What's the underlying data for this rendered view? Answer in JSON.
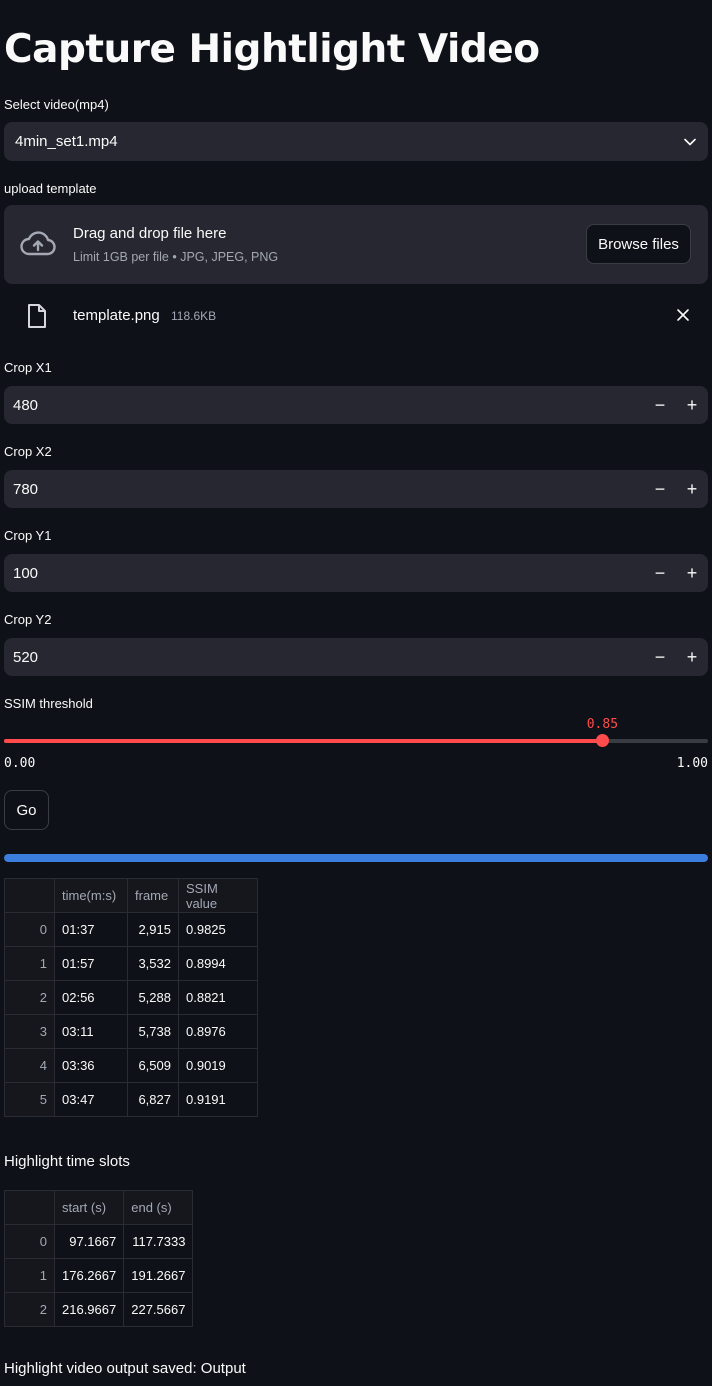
{
  "title": "Capture Hightlight Video",
  "video_select": {
    "label": "Select video(mp4)",
    "value": "4min_set1.mp4"
  },
  "uploader": {
    "label": "upload template",
    "drag_text": "Drag and drop file here",
    "limit_text": "Limit 1GB per file • JPG, JPEG, PNG",
    "browse_label": "Browse files",
    "file_name": "template.png",
    "file_size": "118.6KB"
  },
  "crop_inputs": [
    {
      "label": "Crop X1",
      "value": "480"
    },
    {
      "label": "Crop X2",
      "value": "780"
    },
    {
      "label": "Crop Y1",
      "value": "100"
    },
    {
      "label": "Crop Y2",
      "value": "520"
    }
  ],
  "stepper": {
    "minus": "−",
    "plus": "+"
  },
  "ssim_slider": {
    "label": "SSIM threshold",
    "value": 0.85,
    "value_text": "0.85",
    "min": 0.0,
    "max": 1.0,
    "min_text": "0.00",
    "max_text": "1.00"
  },
  "go_button": "Go",
  "progress": 1.0,
  "results_table": {
    "columns": [
      "time(m:s)",
      "frame",
      "SSIM value"
    ],
    "rows": [
      {
        "index": "0",
        "time": "01:37",
        "frame": "2,915",
        "ssim": "0.9825"
      },
      {
        "index": "1",
        "time": "01:57",
        "frame": "3,532",
        "ssim": "0.8994"
      },
      {
        "index": "2",
        "time": "02:56",
        "frame": "5,288",
        "ssim": "0.8821"
      },
      {
        "index": "3",
        "time": "03:11",
        "frame": "5,738",
        "ssim": "0.8976"
      },
      {
        "index": "4",
        "time": "03:36",
        "frame": "6,509",
        "ssim": "0.9019"
      },
      {
        "index": "5",
        "time": "03:47",
        "frame": "6,827",
        "ssim": "0.9191"
      }
    ]
  },
  "slots_heading": "Highlight time slots",
  "slots_table": {
    "columns": [
      "start (s)",
      "end (s)"
    ],
    "rows": [
      {
        "index": "0",
        "start": "97.1667",
        "end": "117.7333"
      },
      {
        "index": "1",
        "start": "176.2667",
        "end": "191.2667"
      },
      {
        "index": "2",
        "start": "216.9667",
        "end": "227.5667"
      }
    ]
  },
  "output_text": "Highlight video output saved: Output",
  "colors": {
    "background": "#0e1117",
    "widget": "#262730",
    "accent_red": "#ff4b4b",
    "progress_blue": "#3c7ede"
  }
}
